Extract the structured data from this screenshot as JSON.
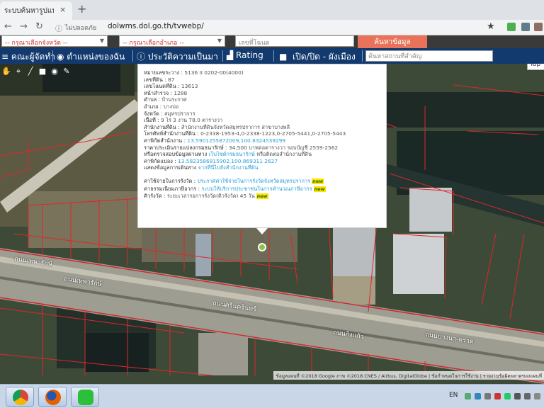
{
  "browser": {
    "tab_title": "ระบบค้นหารูปแปลงที่ดิน",
    "tab_close": "×",
    "new_tab": "+",
    "back_icon": "arrow-left",
    "forward_icon": "arrow-right",
    "reload_icon": "reload",
    "security_text": "ไม่ปลอดภัย",
    "url": "dolwms.dol.go.th/tvwebp/",
    "star_icon": "★"
  },
  "search": {
    "province_placeholder": "-- กรุณาเลือกจังหวัด --",
    "amphoe_placeholder": "-- กรุณาเลือกอำเภอ --",
    "parcel_placeholder": "เลขที่โฉนด",
    "search_button": "ค้นหาข้อมูล"
  },
  "menu": {
    "items": [
      {
        "label": "คณะผู้จัดทำ",
        "icon": "group-icon"
      },
      {
        "label": "ตำแหน่งของฉัน",
        "icon": "my-location-icon"
      },
      {
        "label": "ประวัติความเป็นมา",
        "icon": "history-icon"
      },
      {
        "label": "Rating",
        "icon": "rating-icon"
      },
      {
        "label": "เปิด/ปิด - ผังเมือง",
        "icon": "toggle-icon"
      }
    ],
    "place_placeholder": "ค้นหาสถานที่สำคัญ"
  },
  "map": {
    "map_type_button": "Top",
    "tools": [
      "✋",
      "⌖",
      "╱",
      "■",
      "◉",
      "✎"
    ],
    "road_labels": [
      "ถนนเทพารักษ์",
      "ถนนเทพารักษ์",
      "ถนนศรีนครินทร์",
      "ถนนกิ่งแก้ว",
      "ถนนบางนา-ตราด"
    ],
    "attribution": "ข้อมูลแผนที่ ©2018 Google ภาพ ©2018 CNES / Airbus, DigitalGlobe | ข้อกำหนดในการใช้งาน | รายงานข้อผิดพลาดของแผนที่"
  },
  "info": {
    "rows": [
      {
        "label": "หมายเลขระวาง :",
        "value": " 5136 II 0202-00(4000)"
      },
      {
        "label": "เลขที่ดิน :",
        "value": " 87"
      },
      {
        "label": "เลขโฉนดที่ดิน :",
        "value": " 13613"
      },
      {
        "label": "หน้าสำรวจ :",
        "value": " 1288"
      },
      {
        "label": "ตำบล :",
        "value": " บ้านระกาศ"
      },
      {
        "label": "อำเภอ :",
        "value": " บางบ่อ"
      },
      {
        "label": "จังหวัด :",
        "value": " สมุทรปราการ"
      },
      {
        "label": "เนื้อที่ :",
        "value": " 9 ไร่ 3 งาน 78.0 ตารางวา"
      },
      {
        "label": "สำนักงานที่ดิน :",
        "value": " สำนักงานที่ดินจังหวัดสมุทรปราการ สาขาบางพลี"
      },
      {
        "label": "โทรศัพท์สำนักงานที่ดิน :",
        "value": " 0-2338-1953-4,0-2338-1223,0-2705-5441,0-2705-5443"
      },
      {
        "label": "ค่าพิกัดสำนักงาน :",
        "value": " 13.5901255872009,100.8324539299",
        "link": true
      },
      {
        "label": "ราคาประเมินรายแปลงกรมธนารักษ์ :",
        "value": " 34,500 บาทต่อตารางวา รอบบัญชี 2559-2562"
      },
      {
        "label": "หรือตรวจสอบข้อมูลผ่านทาง",
        "value": " เว็บไซต์กรมธนารักษ์",
        "link": true,
        "suffix": " หรือติดต่อสำนักงานที่ดิน"
      },
      {
        "label": "ค่าพิกัดแปลง :",
        "value": " 13.5823586815902,100.869311 2627",
        "link": true
      },
      {
        "label": "แสดงข้อมูลการเดินทาง",
        "value": " จากที่นี่ไปยังสำนักงานที่ดิน",
        "link": true
      }
    ],
    "extra_rows": [
      {
        "label": "ค่าใช้จ่ายในการรังวัด :",
        "value": " ประกาศค่าใช้จ่ายในการรังวัดจังหวัดสมุทรปราการ",
        "badge": "new"
      },
      {
        "label": "ค่าธรรมเนียมภาษีอากร :",
        "value": " ระบบให้บริการประชาชนในการคำนวณภาษีอากร",
        "badge": "new"
      },
      {
        "label": "คิวรังวัด :",
        "value": " ระยะเวลารอการรังวัด(คิวรังวัด) 45 วัน",
        "badge": "new",
        "plain": true
      }
    ]
  },
  "taskbar": {
    "apps": [
      {
        "name": "chrome-icon",
        "color": "#d9412a"
      },
      {
        "name": "firefox-icon",
        "color": "#e66000"
      },
      {
        "name": "line-icon",
        "color": "#2cbf3a"
      }
    ],
    "language": "EN"
  }
}
